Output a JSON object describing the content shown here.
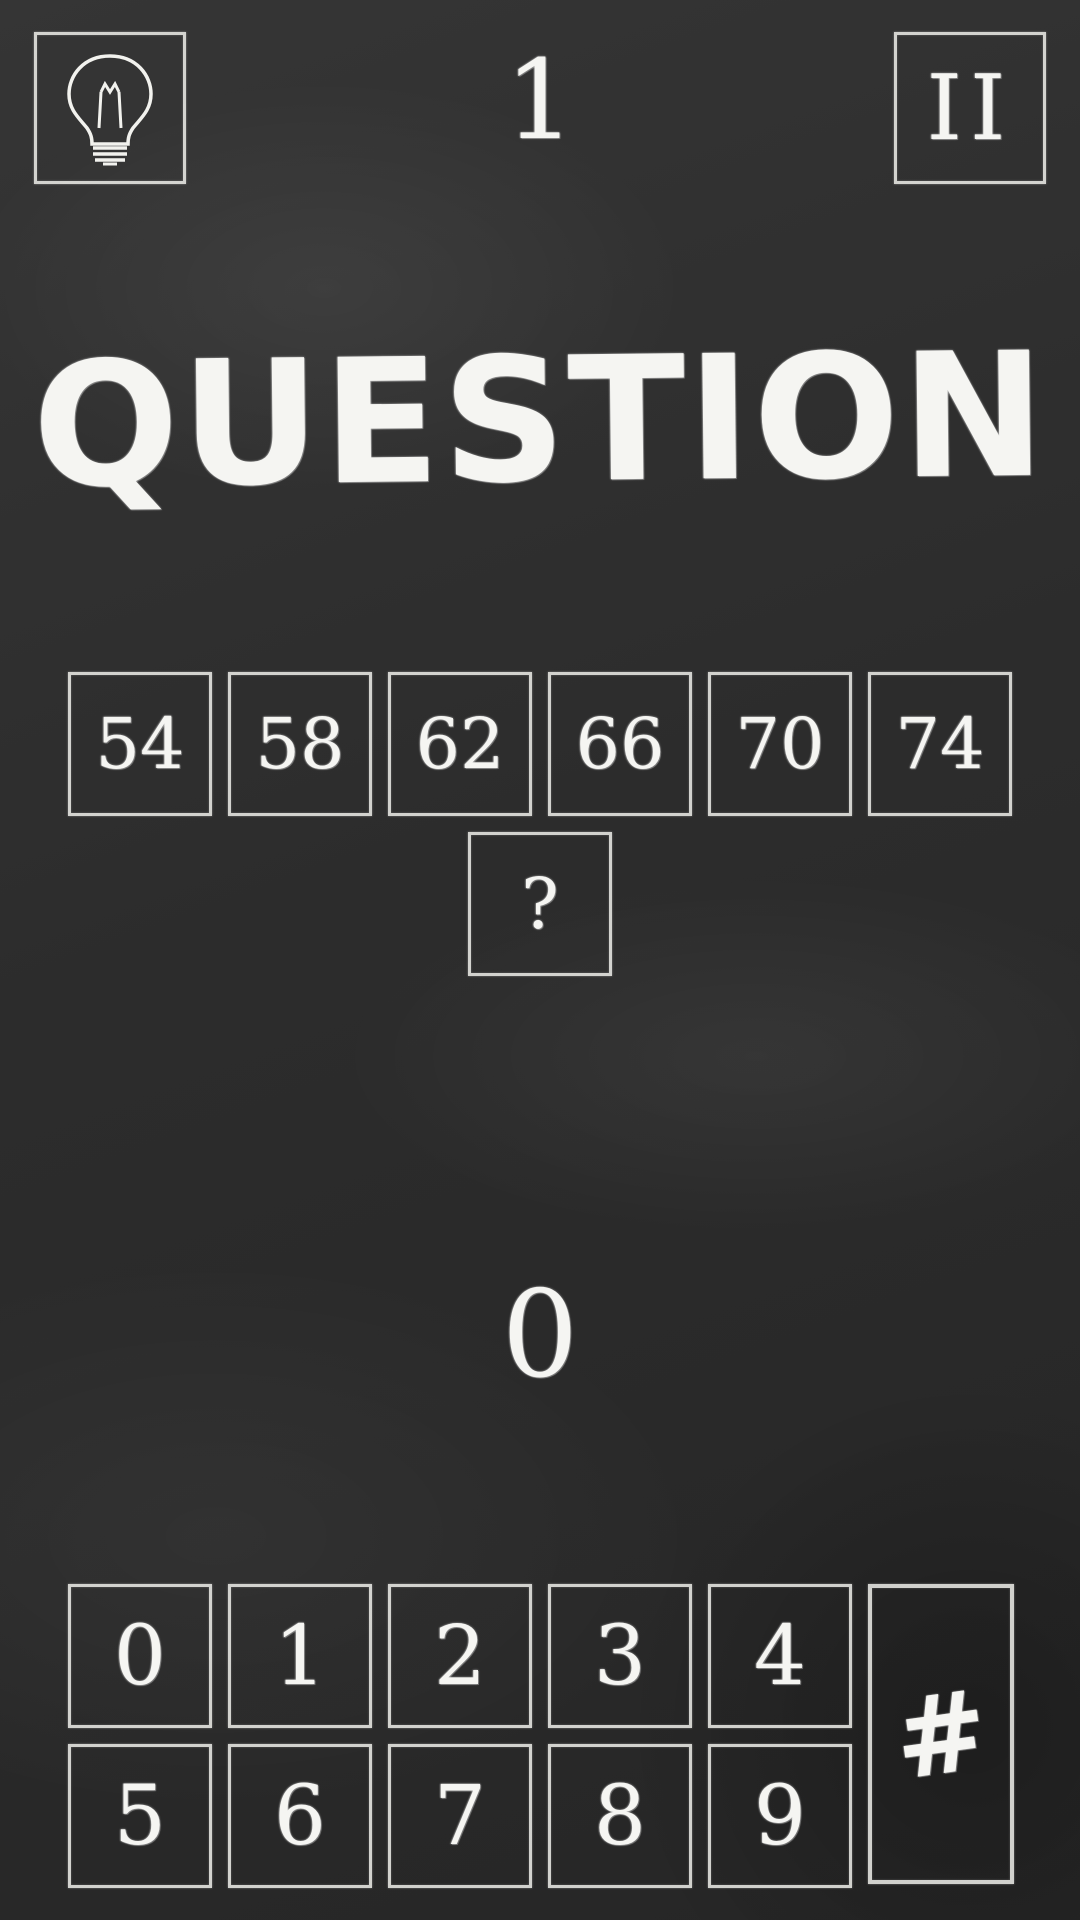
{
  "header": {
    "hint_icon": "lightbulb-icon",
    "level": "1",
    "pause_label": "II"
  },
  "title": "QUESTION",
  "sequence": [
    "54",
    "58",
    "62",
    "66",
    "70",
    "74"
  ],
  "unknown": "?",
  "answer": "0",
  "keypad": {
    "row1": [
      "0",
      "1",
      "2",
      "3",
      "4"
    ],
    "row2": [
      "5",
      "6",
      "7",
      "8",
      "9"
    ],
    "submit_label": "#"
  },
  "colors": {
    "board": "#2c2c2c",
    "chalk": "#f5f5f2"
  }
}
